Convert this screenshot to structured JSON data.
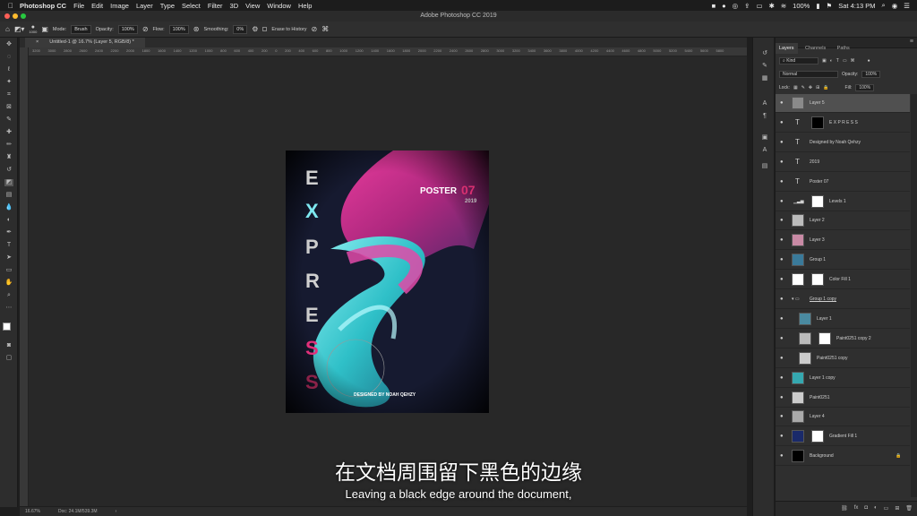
{
  "menubar": {
    "app": "Photoshop CC",
    "items": [
      "File",
      "Edit",
      "Image",
      "Layer",
      "Type",
      "Select",
      "Filter",
      "3D",
      "View",
      "Window",
      "Help"
    ],
    "battery": "100%",
    "clock": "Sat 4:13 PM"
  },
  "window_title": "Adobe Photoshop CC 2019",
  "options": {
    "brush_size": "1000",
    "mode_label": "Mode:",
    "mode_value": "Brush",
    "opacity_label": "Opacity:",
    "opacity_value": "100%",
    "flow_label": "Flow:",
    "flow_value": "100%",
    "smoothing_label": "Smoothing:",
    "smoothing_value": "0%",
    "erase_history": "Erase to History"
  },
  "document_tab": "Untitled-1 @ 16.7% (Layer 5, RGB/8) *",
  "ruler_ticks": "3200  3000  2800  2600  2400  2200  2000  1800  1600  1400  1200  1000  800  600  400  200  0  200  400  600  800  1000  1200  1400  1600  1800  2000  2200  2400  2600  2800  3000  3200  3400  3600  3800  4000  4200  4400  4600  4800  5000  5200  5400  5600  5800",
  "status": {
    "zoom": "16.67%",
    "doc": "Doc: 24.1M/539.3M"
  },
  "poster": {
    "letters": [
      "E",
      "X",
      "P",
      "R",
      "E",
      "S",
      "S"
    ],
    "title": "POSTER",
    "number": "07",
    "year": "2019",
    "credit": "DESIGNED BY NOAH QEHZY"
  },
  "panel": {
    "tabs": [
      "Layers",
      "Channels",
      "Paths"
    ],
    "filter_kind": "Kind",
    "blend_mode": "Normal",
    "opacity_label": "Opacity:",
    "opacity_value": "100%",
    "lock_label": "Lock:",
    "fill_label": "Fill:",
    "fill_value": "100%",
    "layers": [
      {
        "name": "Layer 5",
        "type": "pixel",
        "selected": true,
        "thumb": "#8a8a8a"
      },
      {
        "name": "E X P R E S S",
        "type": "text",
        "mask": true,
        "thumb": "#000000"
      },
      {
        "name": "Designed by Noah Qehzy",
        "type": "text"
      },
      {
        "name": "2019",
        "type": "text"
      },
      {
        "name": "Poster 07",
        "type": "text"
      },
      {
        "name": "Levels 1",
        "type": "adjust",
        "mask": true,
        "thumb": "#ffffff"
      },
      {
        "name": "Layer 2",
        "type": "pixel",
        "thumb": "#bbbbbb"
      },
      {
        "name": "Layer 3",
        "type": "pixel",
        "thumb": "#c98aa5"
      },
      {
        "name": "Group 1",
        "type": "pixel",
        "thumb": "#3a7a9a"
      },
      {
        "name": "Color Fill 1",
        "type": "fill",
        "mask": true,
        "thumb": "#ffffff"
      },
      {
        "name": "Group 1 copy",
        "type": "group"
      },
      {
        "name": "Layer 1",
        "type": "pixel",
        "indent": true,
        "thumb": "#4a8aa0"
      },
      {
        "name": "Paint0251 copy 2",
        "type": "pixel",
        "indent": true,
        "mask": true,
        "thumb": "#bbbbbb"
      },
      {
        "name": "Paint0251 copy",
        "type": "pixel",
        "indent": true,
        "thumb": "#cccccc"
      },
      {
        "name": "Layer 1 copy",
        "type": "pixel",
        "thumb": "#35a8b0"
      },
      {
        "name": "Paint0251",
        "type": "pixel",
        "thumb": "#cccccc"
      },
      {
        "name": "Layer 4",
        "type": "pixel",
        "thumb": "#aaaaaa"
      },
      {
        "name": "Gradient Fill 1",
        "type": "fill",
        "mask": true,
        "thumb": "#1a2a6a"
      },
      {
        "name": "Background",
        "type": "pixel",
        "locked": true,
        "thumb": "#000000"
      }
    ]
  },
  "subtitle": {
    "zh": "在文档周围留下黑色的边缘",
    "en": "Leaving a black edge around the document,"
  }
}
